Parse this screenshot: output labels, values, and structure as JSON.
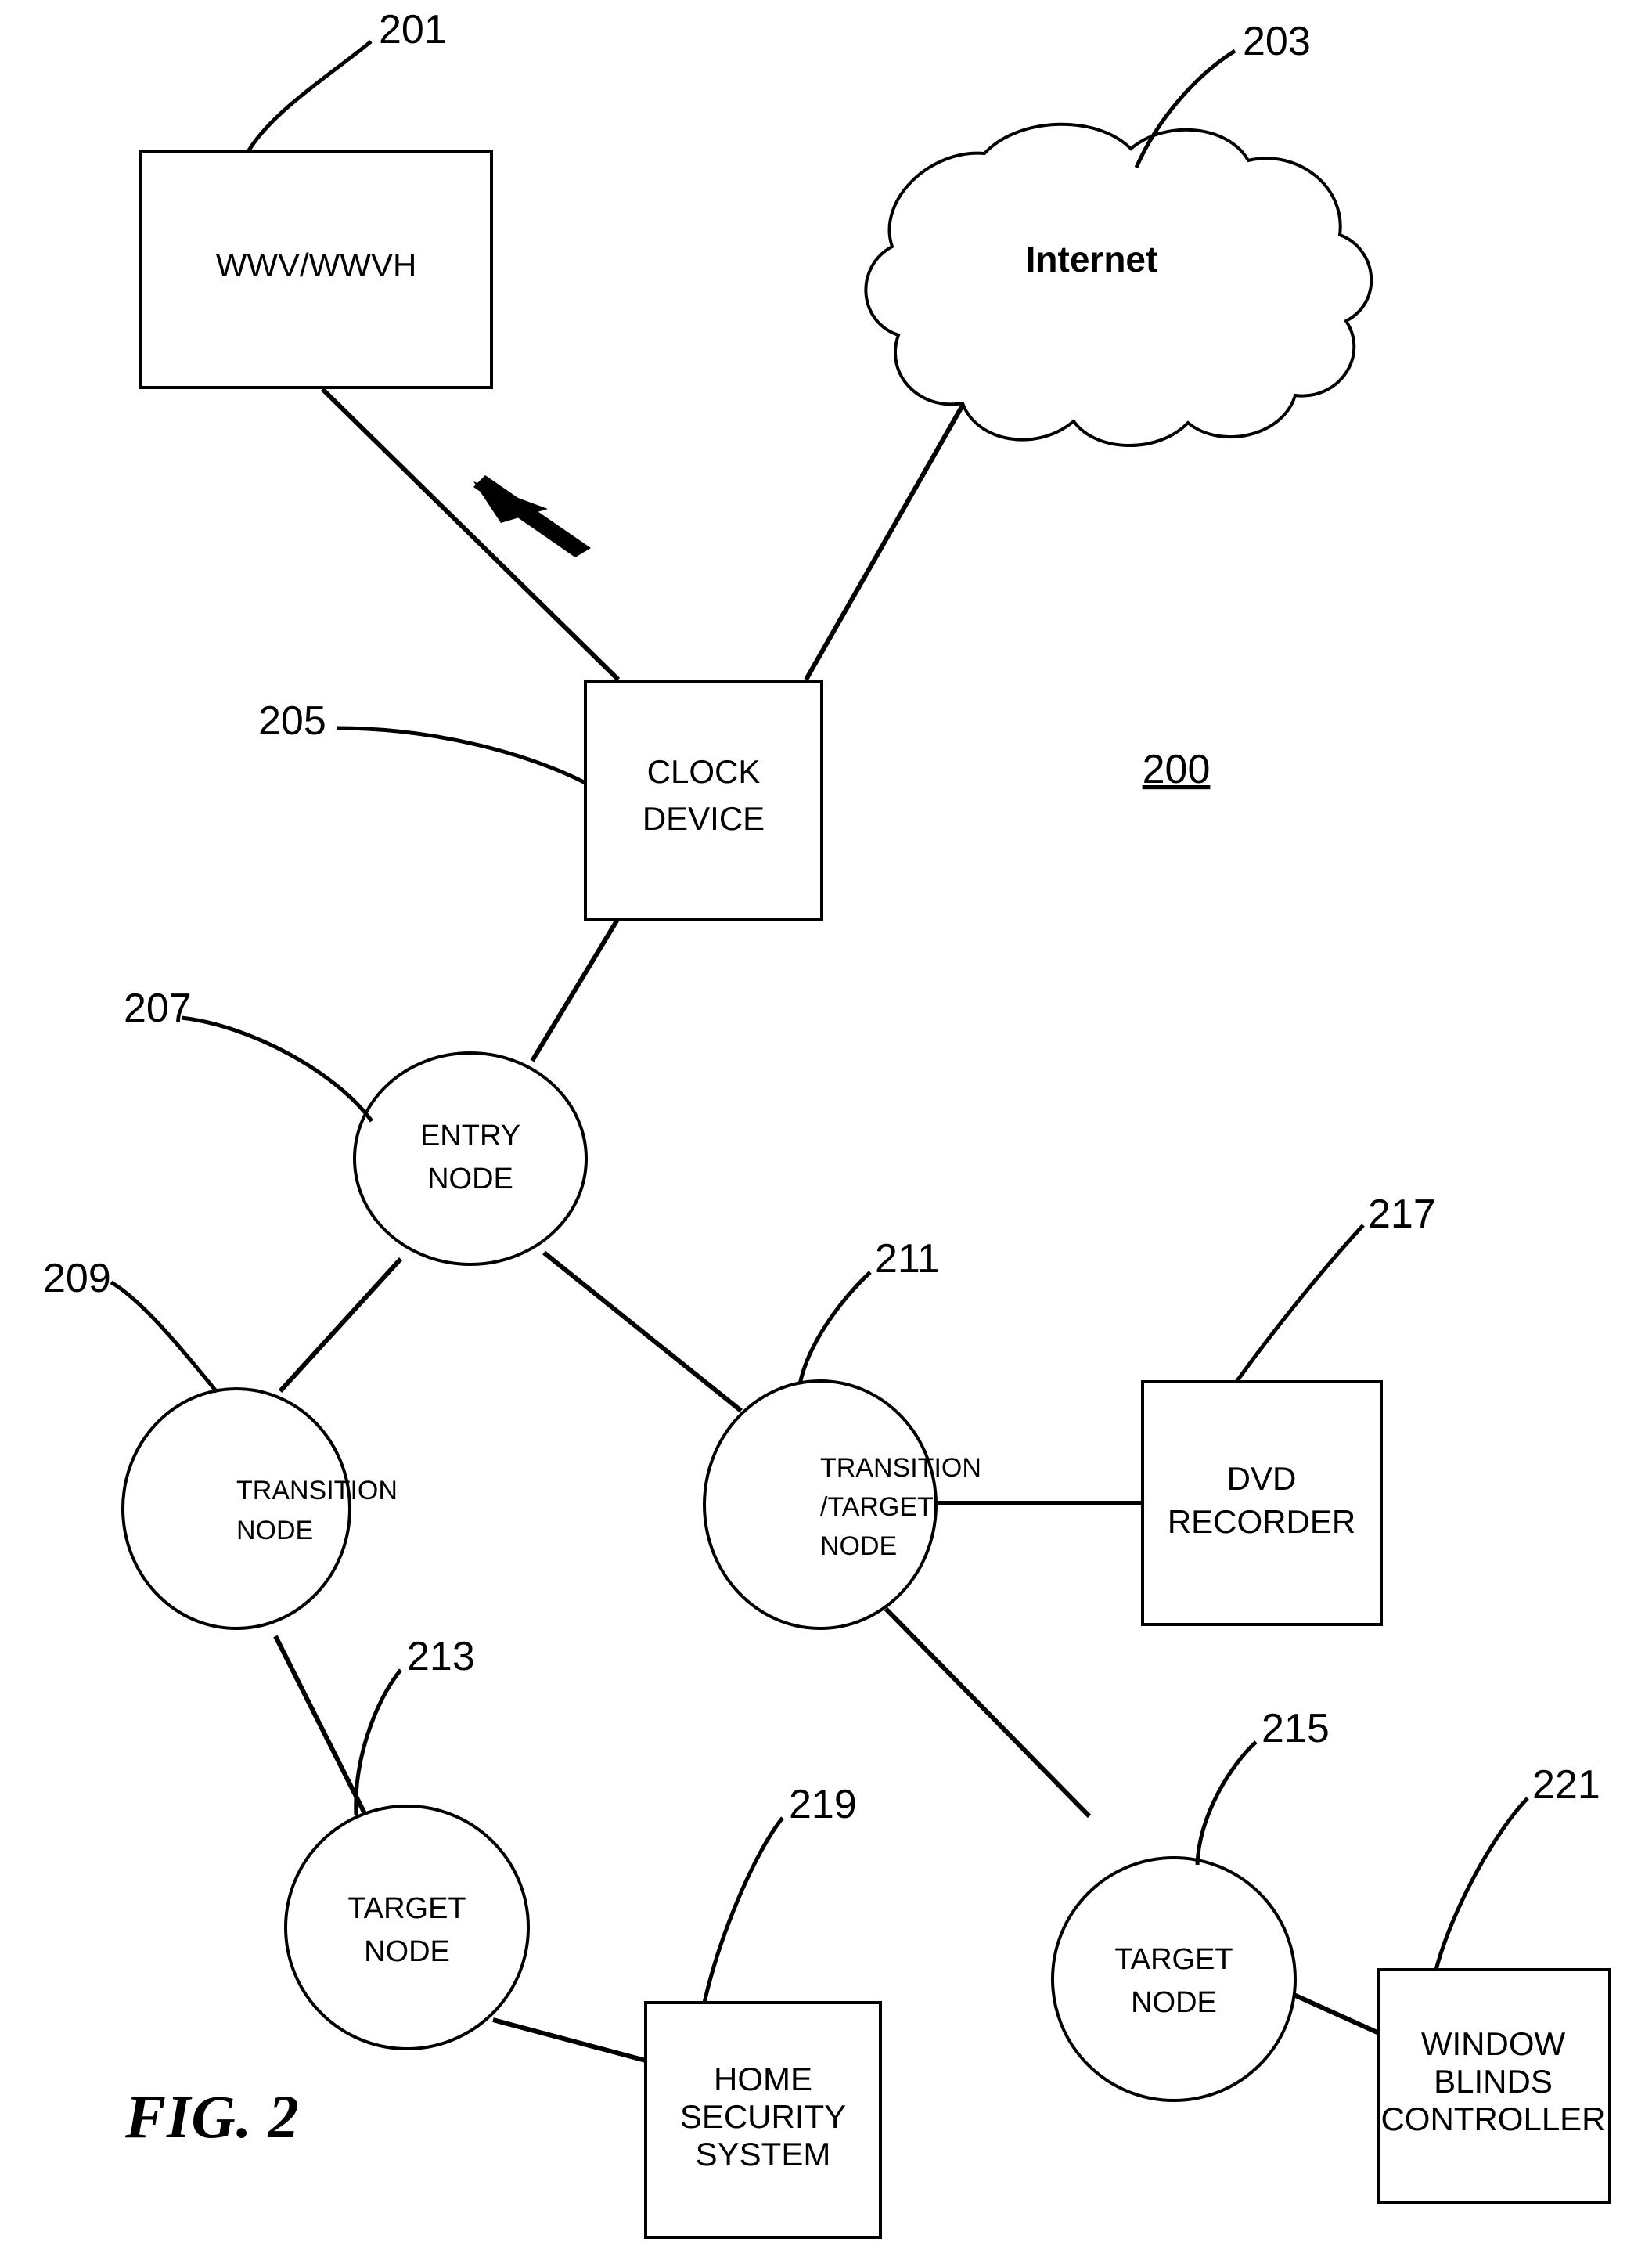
{
  "figure": {
    "label": "FIG. 2",
    "system_number": "200"
  },
  "boxes": [
    {
      "id": "wwv",
      "lines": [
        "WWV/WWVH"
      ],
      "ref": "201"
    },
    {
      "id": "clock",
      "lines": [
        "CLOCK",
        "DEVICE"
      ],
      "ref": "205"
    },
    {
      "id": "dvd",
      "lines": [
        "DVD",
        "RECORDER"
      ],
      "ref": "217"
    },
    {
      "id": "security",
      "lines": [
        "HOME",
        "SECURITY",
        "SYSTEM"
      ],
      "ref": "219"
    },
    {
      "id": "blinds",
      "lines": [
        "WINDOW",
        "BLINDS",
        "CONTROLLER"
      ],
      "ref": "221"
    }
  ],
  "cloud": {
    "label": "Internet",
    "ref": "203"
  },
  "nodes": [
    {
      "id": "entry",
      "lines": [
        "ENTRY",
        "NODE"
      ],
      "ref": "207"
    },
    {
      "id": "transition",
      "lines": [
        "TRANSITION",
        "NODE"
      ],
      "ref": "209"
    },
    {
      "id": "transtarget",
      "lines": [
        "TRANSITION",
        "/TARGET",
        "NODE"
      ],
      "ref": "211"
    },
    {
      "id": "target_left",
      "lines": [
        "TARGET",
        "NODE"
      ],
      "ref": "213"
    },
    {
      "id": "target_right",
      "lines": [
        "TARGET",
        "NODE"
      ],
      "ref": "215"
    }
  ],
  "text": {
    "wwv_line1": "WWV/WWVH",
    "clock_line1": "CLOCK",
    "clock_line2": "DEVICE",
    "internet": "Internet",
    "entry_line1": "ENTRY",
    "entry_line2": "NODE",
    "transition_line1": "TRANSITION",
    "transition_line2": "NODE",
    "transtarget_line1": "TRANSITION",
    "transtarget_line2": "/TARGET",
    "transtarget_line3": "NODE",
    "target_left_line1": "TARGET",
    "target_left_line2": "NODE",
    "target_right_line1": "TARGET",
    "target_right_line2": "NODE",
    "dvd_line1": "DVD",
    "dvd_line2": "RECORDER",
    "security_line1": "HOME",
    "security_line2": "SECURITY",
    "security_line3": "SYSTEM",
    "blinds_line1": "WINDOW",
    "blinds_line2": "BLINDS",
    "blinds_line3": "CONTROLLER",
    "ref_201": "201",
    "ref_203": "203",
    "ref_205": "205",
    "ref_207": "207",
    "ref_209": "209",
    "ref_211": "211",
    "ref_213": "213",
    "ref_215": "215",
    "ref_217": "217",
    "ref_219": "219",
    "ref_221": "221",
    "system_200": "200",
    "figure_label": "FIG. 2"
  },
  "colors": {
    "ink": "#000000",
    "paper": "#ffffff"
  }
}
